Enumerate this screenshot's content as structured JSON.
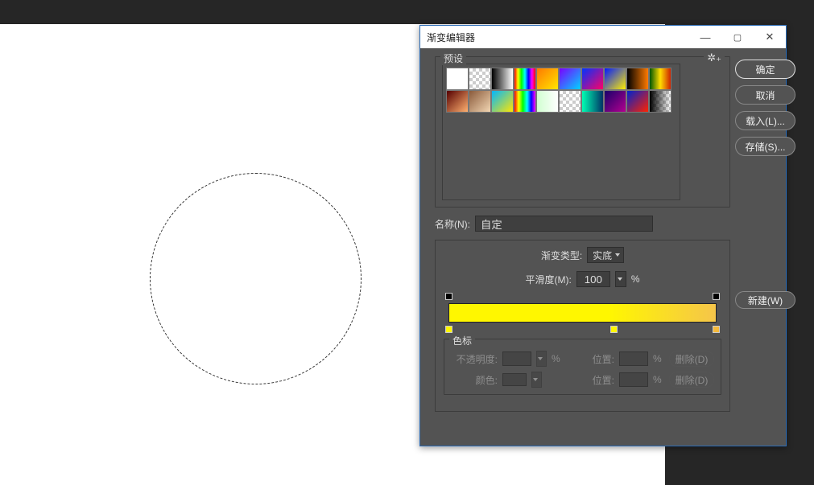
{
  "dialog": {
    "title": "渐变编辑器",
    "preset_label": "预设",
    "name_label": "名称(N):",
    "name_value": "自定",
    "type_label": "渐变类型:",
    "type_value": "实底",
    "smooth_label": "平滑度(M):",
    "smooth_value": "100",
    "smooth_unit": "%",
    "stops_label": "色标",
    "opacity_label": "不透明度:",
    "opacity_unit": "%",
    "pos_label": "位置:",
    "pos_unit": "%",
    "color_label": "颜色:",
    "delete_label": "删除(D)"
  },
  "buttons": {
    "ok": "确定",
    "cancel": "取消",
    "load": "载入(L)...",
    "save": "存储(S)...",
    "new": "新建(W)"
  }
}
